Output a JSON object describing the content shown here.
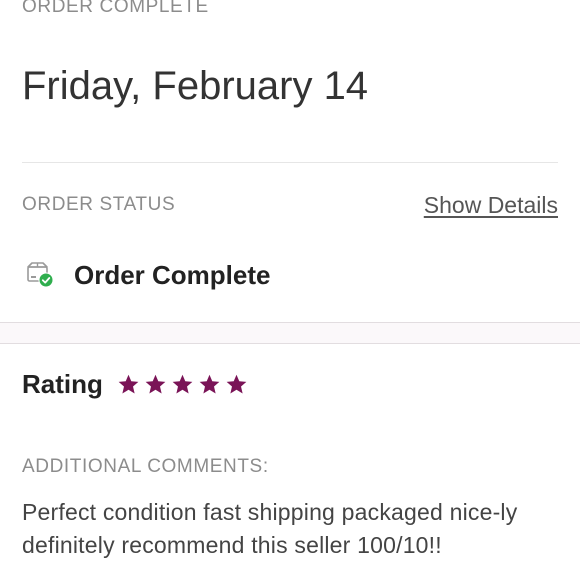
{
  "header": {
    "eyebrow": "ORDER COMPLETE",
    "date": "Friday, February 14"
  },
  "order_status": {
    "label": "ORDER STATUS",
    "show_details": "Show Details",
    "status_text": "Order Complete",
    "icon": "package-check-icon"
  },
  "rating": {
    "label": "Rating",
    "stars": 5,
    "max_stars": 5,
    "star_color": "#7a1457"
  },
  "comments": {
    "label": "ADDITIONAL COMMENTS:",
    "text": "Perfect condition fast shipping packaged nice-ly definitely recommend this seller 100/10!!"
  },
  "colors": {
    "accent": "#7a1457",
    "success": "#2fae4e"
  }
}
